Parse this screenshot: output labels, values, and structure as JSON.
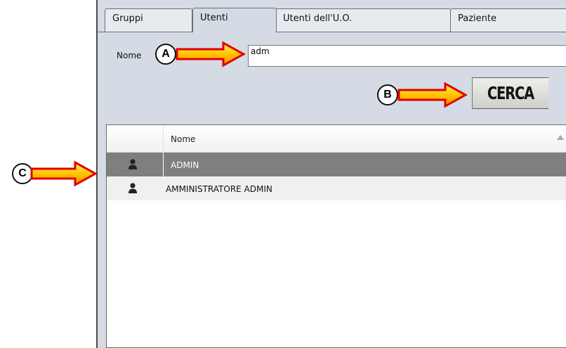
{
  "tabs": [
    {
      "label": "Gruppi"
    },
    {
      "label": "Utenti"
    },
    {
      "label": "Utenti dell'U.O."
    },
    {
      "label": "Paziente"
    }
  ],
  "search": {
    "label": "Nome",
    "value": "adm"
  },
  "cerca_label": "CERCA",
  "list": {
    "column_header": "Nome",
    "rows": [
      {
        "label": "ADMIN",
        "selected": true,
        "icon": "user-icon"
      },
      {
        "label": "AMMINISTRATORE ADMIN",
        "selected": false,
        "icon": "user-icon"
      }
    ]
  },
  "annotations": {
    "a": "A",
    "b": "B",
    "c": "C"
  },
  "colors": {
    "panel_bg": "#d4dbe4",
    "selected_row": "#7f7f7f",
    "arrow_fill": "#ffd700",
    "arrow_outline": "#e00000"
  }
}
